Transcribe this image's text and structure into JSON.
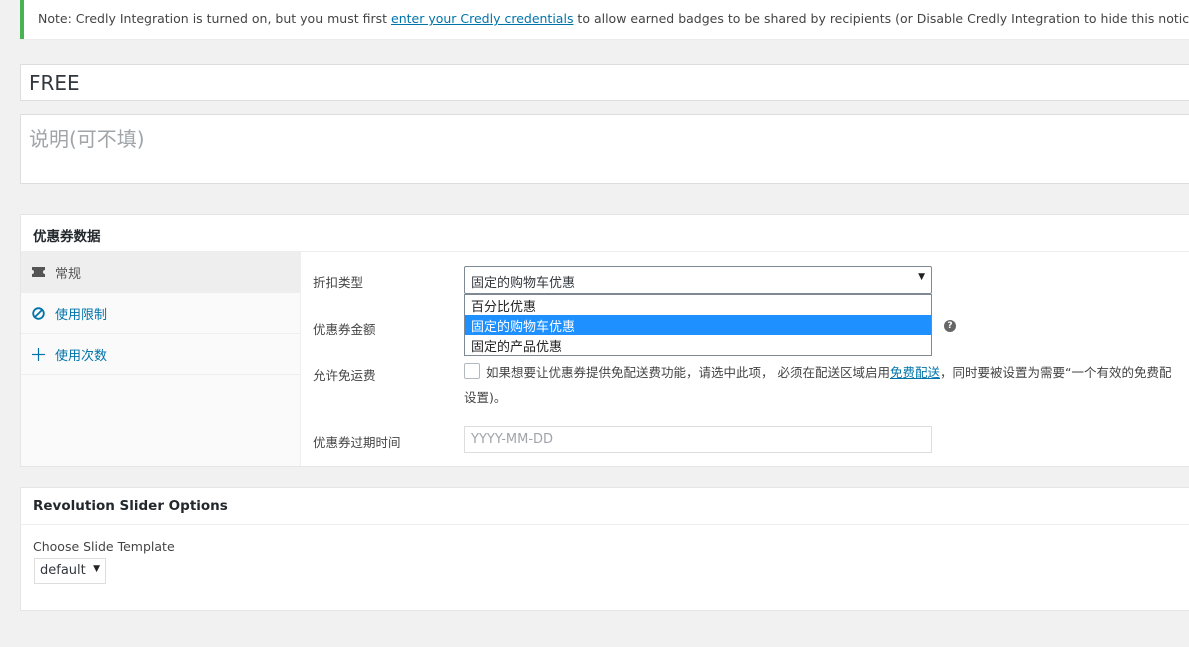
{
  "notice": {
    "prefix": "Note: Credly Integration is turned on, but you must first ",
    "link": "enter your Credly credentials",
    "suffix": " to allow earned badges to be shared by recipients (or Disable Credly Integration to hide this notice)."
  },
  "title_value": "FREE",
  "excerpt_placeholder": "说明(可不填)",
  "coupon": {
    "header": "优惠券数据",
    "tabs": [
      {
        "label": "常规",
        "icon": "ticket-icon"
      },
      {
        "label": "使用限制",
        "icon": "block-icon"
      },
      {
        "label": "使用次数",
        "icon": "plus-cross-icon"
      }
    ],
    "fields": {
      "discount_type_label": "折扣类型",
      "discount_type_value": "固定的购物车优惠",
      "discount_options": [
        "百分比优惠",
        "固定的购物车优惠",
        "固定的产品优惠"
      ],
      "amount_label": "优惠券金额",
      "free_shipping_label": "允许免运费",
      "free_shipping_desc_before": "如果想要让优惠券提供免配送费功能，请选中此项， 必须在配送区域启用",
      "free_shipping_link": "免费配送",
      "free_shipping_desc_after": "，同时要被设置为需要“一个有效的免费配",
      "free_shipping_desc_line2": "设置)。",
      "expiry_label": "优惠券过期时间",
      "expiry_placeholder": "YYYY-MM-DD"
    }
  },
  "revslider": {
    "header": "Revolution Slider Options",
    "template_label": "Choose Slide Template",
    "template_value": "default"
  },
  "colors": {
    "notice_accent": "#46b450",
    "link": "#0073aa",
    "selected_option": "#1e90ff"
  }
}
